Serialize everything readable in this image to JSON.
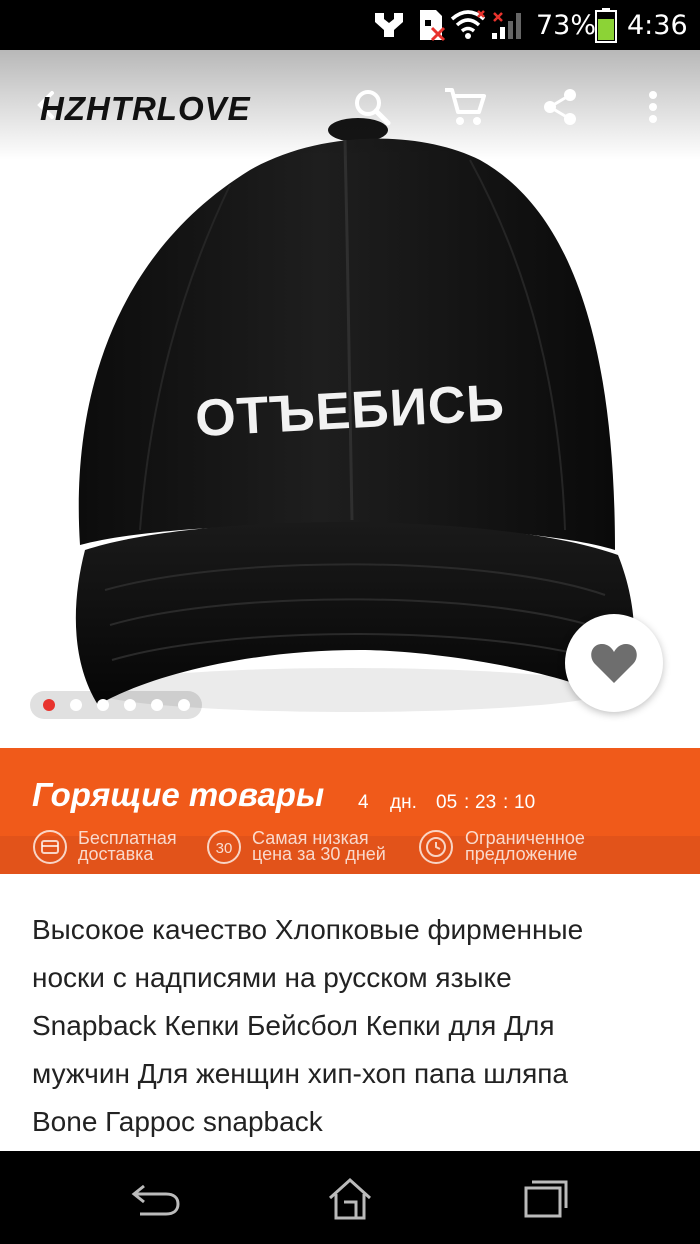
{
  "status_bar": {
    "battery_percent": "73%",
    "battery_level": 0.73,
    "time": "4:36"
  },
  "header": {
    "brand": "HZHTRLOVE",
    "icons": [
      "back-arrow-icon",
      "search-icon",
      "cart-icon",
      "share-icon",
      "more-icon"
    ]
  },
  "product_image": {
    "cap_text": "ОТЪЕБИСЬ",
    "carousel_dots": 6,
    "active_dot": 0
  },
  "deals": {
    "title": "Горящие товары",
    "days": "4",
    "days_label": "дн.",
    "hours": "05",
    "minutes": "23",
    "seconds": "10",
    "features": [
      {
        "icon": "delivery-icon",
        "line1": "Бесплатная",
        "line2": "доставка"
      },
      {
        "icon": "30-days-icon",
        "icon_text": "30",
        "line1": "Самая низкая",
        "line2": "цена за 30 дней"
      },
      {
        "icon": "clock-icon",
        "line1": "Ограниченное",
        "line2": "предложение"
      }
    ]
  },
  "product": {
    "title_lines": [
      "Высокое качество Хлопковые фирменные",
      "носки с надписями на русском языке",
      "Snapback Кепки Бейсбол Кепки для Для",
      "мужчин Для женщин хип-хоп папа шляпа",
      "Bone Гаррос snapback"
    ]
  },
  "colors": {
    "accent_orange": "#f05a1a",
    "dot_active": "#e8332d"
  }
}
